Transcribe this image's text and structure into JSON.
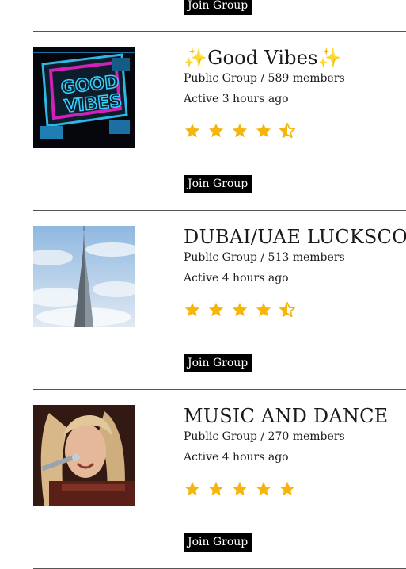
{
  "top_join_label": "Join Group",
  "groups": [
    {
      "title": "✨Good Vibes✨",
      "meta": "Public Group / 589 members",
      "active": "Active 3 hours ago",
      "rating": 4.5,
      "join_label": "Join Group",
      "image_alt": "good-vibes-neon-sign"
    },
    {
      "title": "DUBAI/UAE LUCKSCOU",
      "meta": "Public Group / 513 members",
      "active": "Active 4 hours ago",
      "rating": 4.5,
      "join_label": "Join Group",
      "image_alt": "burj-khalifa-tower"
    },
    {
      "title": "MUSIC AND DANCE",
      "meta": "Public Group / 270 members",
      "active": "Active 4 hours ago",
      "rating": 5,
      "join_label": "Join Group",
      "image_alt": "singer-at-microphone"
    }
  ],
  "colors": {
    "star": "#f5b50a",
    "button_bg": "#000000",
    "button_text": "#ffffff"
  }
}
